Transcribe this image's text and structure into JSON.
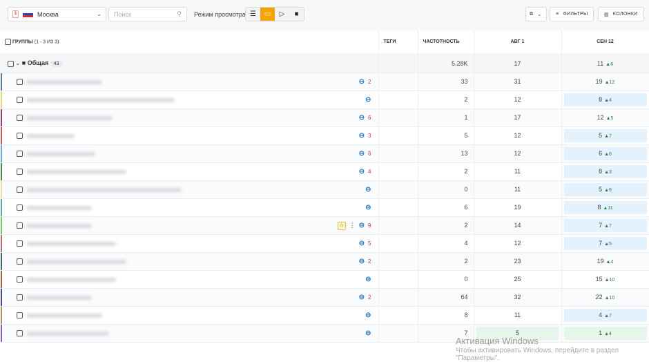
{
  "toolbar": {
    "region": "Москва",
    "search_placeholder": "Поиск",
    "view_mode_label": "Режим просмотра:",
    "filters": "ФИЛЬТРЫ",
    "columns": "КОЛОНКИ"
  },
  "table": {
    "headers": {
      "groups": "ГРУППЫ",
      "groups_count": "(1 - 3 ИЗ 3)",
      "tags": "ТЕГИ",
      "frequency": "ЧАСТОТНОСТЬ",
      "date1": "АВГ 1",
      "date2": "СЕН 12"
    },
    "group": {
      "name": "Общая",
      "count": "43",
      "frequency": "5.28K",
      "date1": "17",
      "date2": "11",
      "date2_delta": "6"
    },
    "rows": [
      {
        "bar": "#5a7ba0",
        "links": "2",
        "freq": "33",
        "d1": "31",
        "d2": "19",
        "delta": "12",
        "hl": ""
      },
      {
        "bar": "#e8d58a",
        "links": "",
        "freq": "2",
        "d1": "12",
        "d2": "8",
        "delta": "4",
        "hl": "blue"
      },
      {
        "bar": "#9b3d6a",
        "links": "6",
        "freq": "1",
        "d1": "17",
        "d2": "12",
        "delta": "5",
        "hl": ""
      },
      {
        "bar": "#cc5555",
        "links": "3",
        "freq": "5",
        "d1": "12",
        "d2": "5",
        "delta": "7",
        "hl": "blue"
      },
      {
        "bar": "#6aa8d6",
        "links": "6",
        "freq": "13",
        "d1": "12",
        "d2": "6",
        "delta": "6",
        "hl": "blue"
      },
      {
        "bar": "#4a8a4a",
        "links": "4",
        "freq": "2",
        "d1": "11",
        "d2": "8",
        "delta": "3",
        "hl": "blue"
      },
      {
        "bar": "#e8e0a0",
        "links": "",
        "freq": "0",
        "d1": "11",
        "d2": "5",
        "delta": "6",
        "hl": "blue"
      },
      {
        "bar": "#5aa8a0",
        "links": "",
        "freq": "6",
        "d1": "19",
        "d2": "8",
        "delta": "11",
        "hl": "blue"
      },
      {
        "bar": "#7ac85a",
        "links": "9",
        "freq": "2",
        "d1": "14",
        "d2": "7",
        "delta": "7",
        "hl": "blue",
        "extra": true
      },
      {
        "bar": "#b07070",
        "links": "5",
        "freq": "4",
        "d1": "12",
        "d2": "7",
        "delta": "5",
        "hl": "blue"
      },
      {
        "bar": "#3a6a6a",
        "links": "2",
        "freq": "2",
        "d1": "23",
        "d2": "19",
        "delta": "4",
        "hl": ""
      },
      {
        "bar": "#a06040",
        "links": "",
        "freq": "0",
        "d1": "25",
        "d2": "15",
        "delta": "10",
        "hl": ""
      },
      {
        "bar": "#404a8a",
        "links": "2",
        "freq": "64",
        "d1": "32",
        "d2": "22",
        "delta": "10",
        "hl": ""
      },
      {
        "bar": "#b09060",
        "links": "",
        "freq": "8",
        "d1": "11",
        "d2": "4",
        "delta": "7",
        "hl": "blue"
      },
      {
        "bar": "#8a60b0",
        "links": "",
        "freq": "7",
        "d1": "5",
        "d2": "1",
        "delta": "4",
        "hl": "green",
        "d1hl": "green"
      }
    ]
  },
  "watermark": {
    "title": "Активация Windows",
    "subtitle": "Чтобы активировать Windows, перейдите в раздел \"Параметры\"."
  }
}
